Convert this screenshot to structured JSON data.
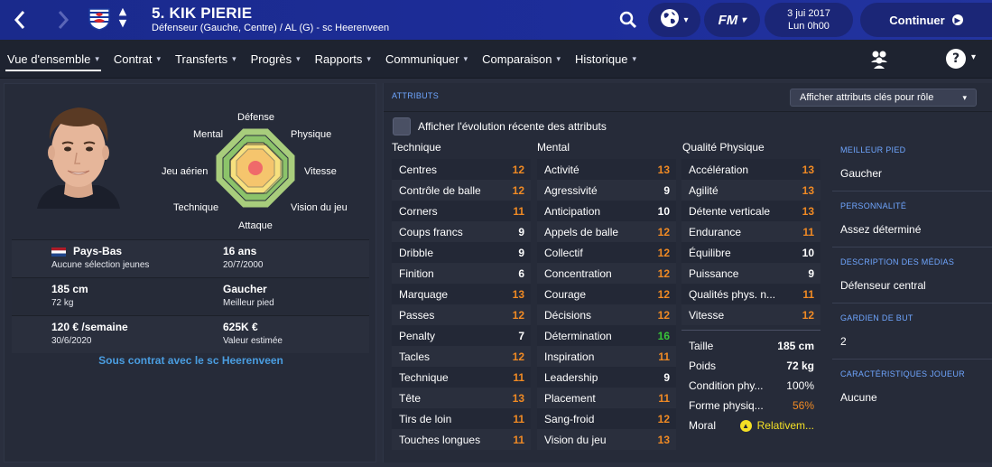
{
  "header": {
    "player_name": "5. KIK PIERIE",
    "player_sub": "Défenseur (Gauche, Centre) / AL (G) - sc Heerenveen",
    "date_line1": "3 jui 2017",
    "date_line2": "Lun 0h00",
    "continue_label": "Continuer",
    "fm_label": "FM"
  },
  "tabs": [
    {
      "label": "Vue d'ensemble"
    },
    {
      "label": "Contrat"
    },
    {
      "label": "Transferts"
    },
    {
      "label": "Progrès"
    },
    {
      "label": "Rapports"
    },
    {
      "label": "Communiquer"
    },
    {
      "label": "Comparaison"
    },
    {
      "label": "Historique"
    }
  ],
  "radar": {
    "defense": "Défense",
    "physique": "Physique",
    "vitesse": "Vitesse",
    "vision": "Vision du jeu",
    "attaque": "Attaque",
    "technique": "Technique",
    "aerien": "Jeu aérien",
    "mental": "Mental"
  },
  "info": {
    "nationality": "Pays-Bas",
    "youth": "Aucune sélection jeunes",
    "age": "16 ans",
    "dob": "20/7/2000",
    "height": "185 cm",
    "weight": "72 kg",
    "foot": "Gaucher",
    "foot_label": "Meilleur pied",
    "wage": "120 € /semaine",
    "contract_end": "30/6/2020",
    "value": "625K €",
    "value_label": "Valeur estimée",
    "contract_text": "Sous contrat avec le sc Heerenveen"
  },
  "attributes": {
    "title": "ATTRIBUTS",
    "key_button": "Afficher attributs clés pour rôle",
    "evolution_label": "Afficher l'évolution récente des attributs",
    "technique_title": "Technique",
    "mental_title": "Mental",
    "physical_title": "Qualité Physique",
    "technique": [
      {
        "name": "Centres",
        "value": "12",
        "color": "orange"
      },
      {
        "name": "Contrôle de balle",
        "value": "12",
        "color": "orange"
      },
      {
        "name": "Corners",
        "value": "11",
        "color": "orange"
      },
      {
        "name": "Coups francs",
        "value": "9",
        "color": "white"
      },
      {
        "name": "Dribble",
        "value": "9",
        "color": "white"
      },
      {
        "name": "Finition",
        "value": "6",
        "color": "white"
      },
      {
        "name": "Marquage",
        "value": "13",
        "color": "orange"
      },
      {
        "name": "Passes",
        "value": "12",
        "color": "orange"
      },
      {
        "name": "Penalty",
        "value": "7",
        "color": "white"
      },
      {
        "name": "Tacles",
        "value": "12",
        "color": "orange"
      },
      {
        "name": "Technique",
        "value": "11",
        "color": "orange"
      },
      {
        "name": "Tête",
        "value": "13",
        "color": "orange"
      },
      {
        "name": "Tirs de loin",
        "value": "11",
        "color": "orange"
      },
      {
        "name": "Touches longues",
        "value": "11",
        "color": "orange"
      }
    ],
    "mental": [
      {
        "name": "Activité",
        "value": "13",
        "color": "orange"
      },
      {
        "name": "Agressivité",
        "value": "9",
        "color": "white"
      },
      {
        "name": "Anticipation",
        "value": "10",
        "color": "white"
      },
      {
        "name": "Appels de balle",
        "value": "12",
        "color": "orange"
      },
      {
        "name": "Collectif",
        "value": "12",
        "color": "orange"
      },
      {
        "name": "Concentration",
        "value": "12",
        "color": "orange"
      },
      {
        "name": "Courage",
        "value": "12",
        "color": "orange"
      },
      {
        "name": "Décisions",
        "value": "12",
        "color": "orange"
      },
      {
        "name": "Détermination",
        "value": "16",
        "color": "green"
      },
      {
        "name": "Inspiration",
        "value": "11",
        "color": "orange"
      },
      {
        "name": "Leadership",
        "value": "9",
        "color": "white"
      },
      {
        "name": "Placement",
        "value": "11",
        "color": "orange"
      },
      {
        "name": "Sang-froid",
        "value": "12",
        "color": "orange"
      },
      {
        "name": "Vision du jeu",
        "value": "13",
        "color": "orange"
      }
    ],
    "physical": [
      {
        "name": "Accélération",
        "value": "13",
        "color": "orange"
      },
      {
        "name": "Agilité",
        "value": "13",
        "color": "orange"
      },
      {
        "name": "Détente verticale",
        "value": "13",
        "color": "orange"
      },
      {
        "name": "Endurance",
        "value": "11",
        "color": "orange"
      },
      {
        "name": "Équilibre",
        "value": "10",
        "color": "white"
      },
      {
        "name": "Puissance",
        "value": "9",
        "color": "white"
      },
      {
        "name": "Qualités phys. n...",
        "value": "11",
        "color": "orange"
      },
      {
        "name": "Vitesse",
        "value": "12",
        "color": "orange"
      }
    ],
    "extra": {
      "taille_label": "Taille",
      "taille": "185 cm",
      "poids_label": "Poids",
      "poids": "72 kg",
      "condition_label": "Condition phy...",
      "condition": "100%",
      "forme_label": "Forme physiq...",
      "forme": "56%",
      "moral_label": "Moral",
      "moral": "Relativem..."
    }
  },
  "side": {
    "foot_title": "MEILLEUR PIED",
    "foot": "Gaucher",
    "personality_title": "PERSONNALITÉ",
    "personality": "Assez déterminé",
    "media_title": "DESCRIPTION DES MÉDIAS",
    "media": "Défenseur central",
    "keeper_title": "GARDIEN DE BUT",
    "keeper": "2",
    "traits_title": "CARACTÉRISTIQUES JOUEUR",
    "traits": "Aucune"
  },
  "colors": {
    "header_blue": "#1d2d9a",
    "orange": "#f08a24",
    "green": "#38c538",
    "link_blue": "#4a9de0",
    "section_blue": "#6fa6ff",
    "moral_yellow": "#f4e025"
  }
}
